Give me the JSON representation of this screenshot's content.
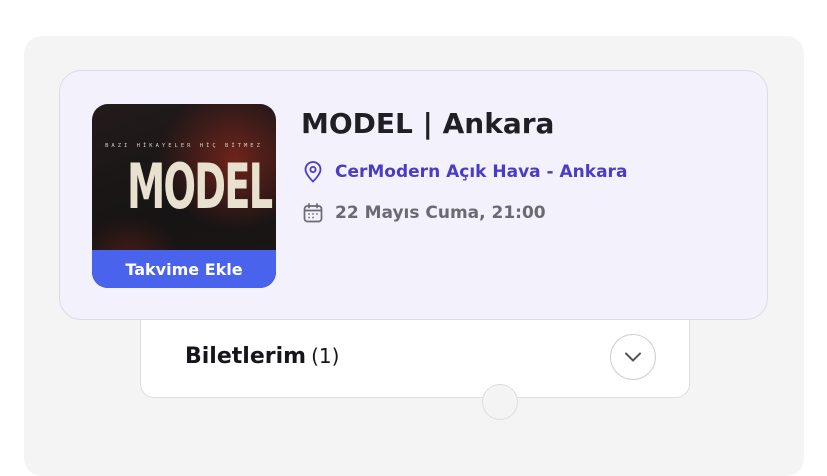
{
  "event": {
    "title": "MODEL | Ankara",
    "venue": "CerModern Açık Hava - Ankara",
    "datetime": "22 Mayıs Cuma, 21:00",
    "poster": {
      "tagline": "BAZI HİKAYELER HİÇ BİTMEZ",
      "title": "MODEL",
      "add_to_calendar_label": "Takvime Ekle"
    }
  },
  "tickets": {
    "label": "Biletlerim",
    "count": "(1)"
  },
  "colors": {
    "accent": "#4b3cc4",
    "button": "#4a63ec",
    "card_bg": "#f2f1fc"
  },
  "icons": {
    "location": "map-pin-icon",
    "date": "calendar-icon",
    "expand": "chevron-down-icon"
  }
}
